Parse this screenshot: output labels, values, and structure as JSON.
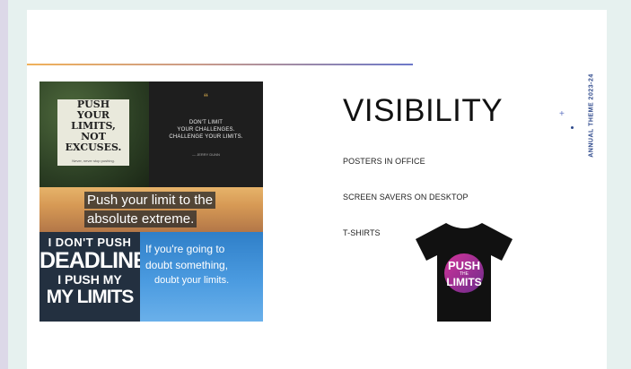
{
  "slide": {
    "heading": "VISIBILITY",
    "items": [
      "POSTERS IN OFFICE",
      "SCREEN SAVERS ON DESKTOP",
      "T-SHIRTS"
    ],
    "side_label": "ANNUAL THEME 2023-24"
  },
  "collage": {
    "poster1": {
      "lines": [
        "PUSH",
        "YOUR",
        "LIMITS,",
        "NOT",
        "EXCUSES."
      ],
      "byline": "Never, never stop pushing."
    },
    "poster2": {
      "quote_mark": "“",
      "lines": [
        "DON'T LIMIT",
        "YOUR CHALLENGES.",
        "CHALLENGE YOUR LIMITS."
      ],
      "author": "— JERRY DUNN"
    },
    "poster3": {
      "line1": "Push your limit to the",
      "line2": "absolute extreme."
    },
    "poster4": {
      "l1": "I DON'T PUSH",
      "l2": "DEADLINES",
      "l3": "I PUSH MY",
      "l4": "MY LIMITS"
    },
    "poster5": {
      "w1": "If you're going to",
      "w2": "doubt something,",
      "w3": "doubt your limits."
    }
  },
  "tshirt": {
    "print_top": "PUSH",
    "print_mid": "THE",
    "print_bottom": "LIMITS"
  },
  "colors": {
    "accent_blue": "#2f4a8c",
    "tshirt": "#111111",
    "background": "#e6f1ef"
  },
  "icons": [
    "plus-icon",
    "dot-icon"
  ]
}
